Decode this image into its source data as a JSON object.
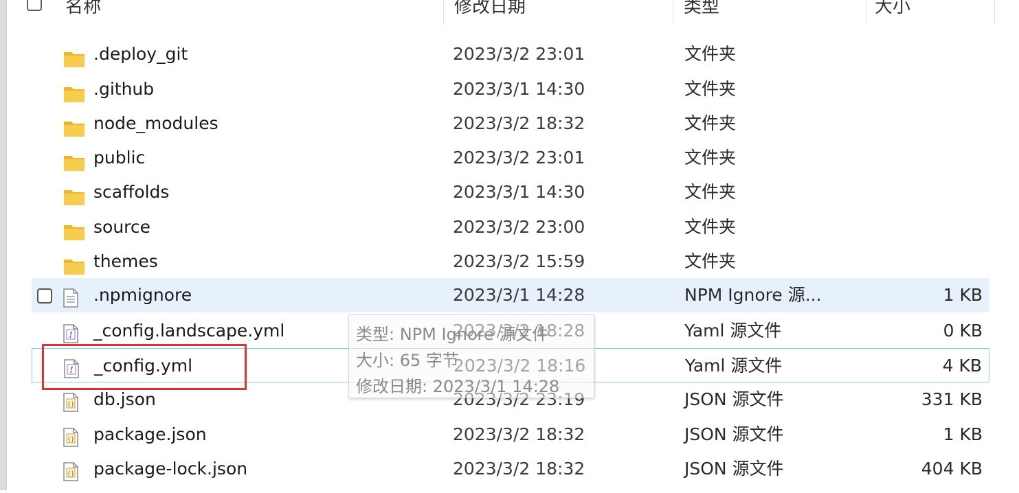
{
  "header": {
    "col_name": "名称",
    "col_date": "修改日期",
    "col_type": "类型",
    "col_size": "大小"
  },
  "files": [
    {
      "name": ".deploy_git",
      "date": "2023/3/2 23:01",
      "type": "文件夹",
      "size": "",
      "icon": "folder-icon"
    },
    {
      "name": ".github",
      "date": "2023/3/1 14:30",
      "type": "文件夹",
      "size": "",
      "icon": "folder-icon"
    },
    {
      "name": "node_modules",
      "date": "2023/3/2 18:32",
      "type": "文件夹",
      "size": "",
      "icon": "folder-icon"
    },
    {
      "name": "public",
      "date": "2023/3/2 23:01",
      "type": "文件夹",
      "size": "",
      "icon": "folder-icon"
    },
    {
      "name": "scaffolds",
      "date": "2023/3/1 14:30",
      "type": "文件夹",
      "size": "",
      "icon": "folder-icon"
    },
    {
      "name": "source",
      "date": "2023/3/2 23:00",
      "type": "文件夹",
      "size": "",
      "icon": "folder-icon"
    },
    {
      "name": "themes",
      "date": "2023/3/2 15:59",
      "type": "文件夹",
      "size": "",
      "icon": "folder-icon"
    },
    {
      "name": ".npmignore",
      "date": "2023/3/1 14:28",
      "type": "NPM Ignore 源...",
      "size": "1 KB",
      "icon": "text-file-icon"
    },
    {
      "name": "_config.landscape.yml",
      "date": "2023/3/2 18:28",
      "type": "Yaml 源文件",
      "size": "0 KB",
      "icon": "yaml-file-icon"
    },
    {
      "name": "_config.yml",
      "date": "2023/3/2 18:16",
      "type": "Yaml 源文件",
      "size": "4 KB",
      "icon": "yaml-file-icon"
    },
    {
      "name": "db.json",
      "date": "2023/3/2 23:19",
      "type": "JSON 源文件",
      "size": "331 KB",
      "icon": "json-file-icon"
    },
    {
      "name": "package.json",
      "date": "2023/3/2 18:32",
      "type": "JSON 源文件",
      "size": "1 KB",
      "icon": "json-file-icon"
    },
    {
      "name": "package-lock.json",
      "date": "2023/3/2 18:32",
      "type": "JSON 源文件",
      "size": "404 KB",
      "icon": "json-file-icon"
    }
  ],
  "tooltip": {
    "type_line": "类型: NPM Ignore 源文件",
    "size_line": "大小: 65 字节",
    "date_line": "修改日期: 2023/3/1 14:28"
  },
  "colors": {
    "hover_row": "#e6f1fb",
    "selected_border": "#8cc3ef",
    "annotation_red": "#e03131",
    "folder_yellow": "#f5c242"
  }
}
